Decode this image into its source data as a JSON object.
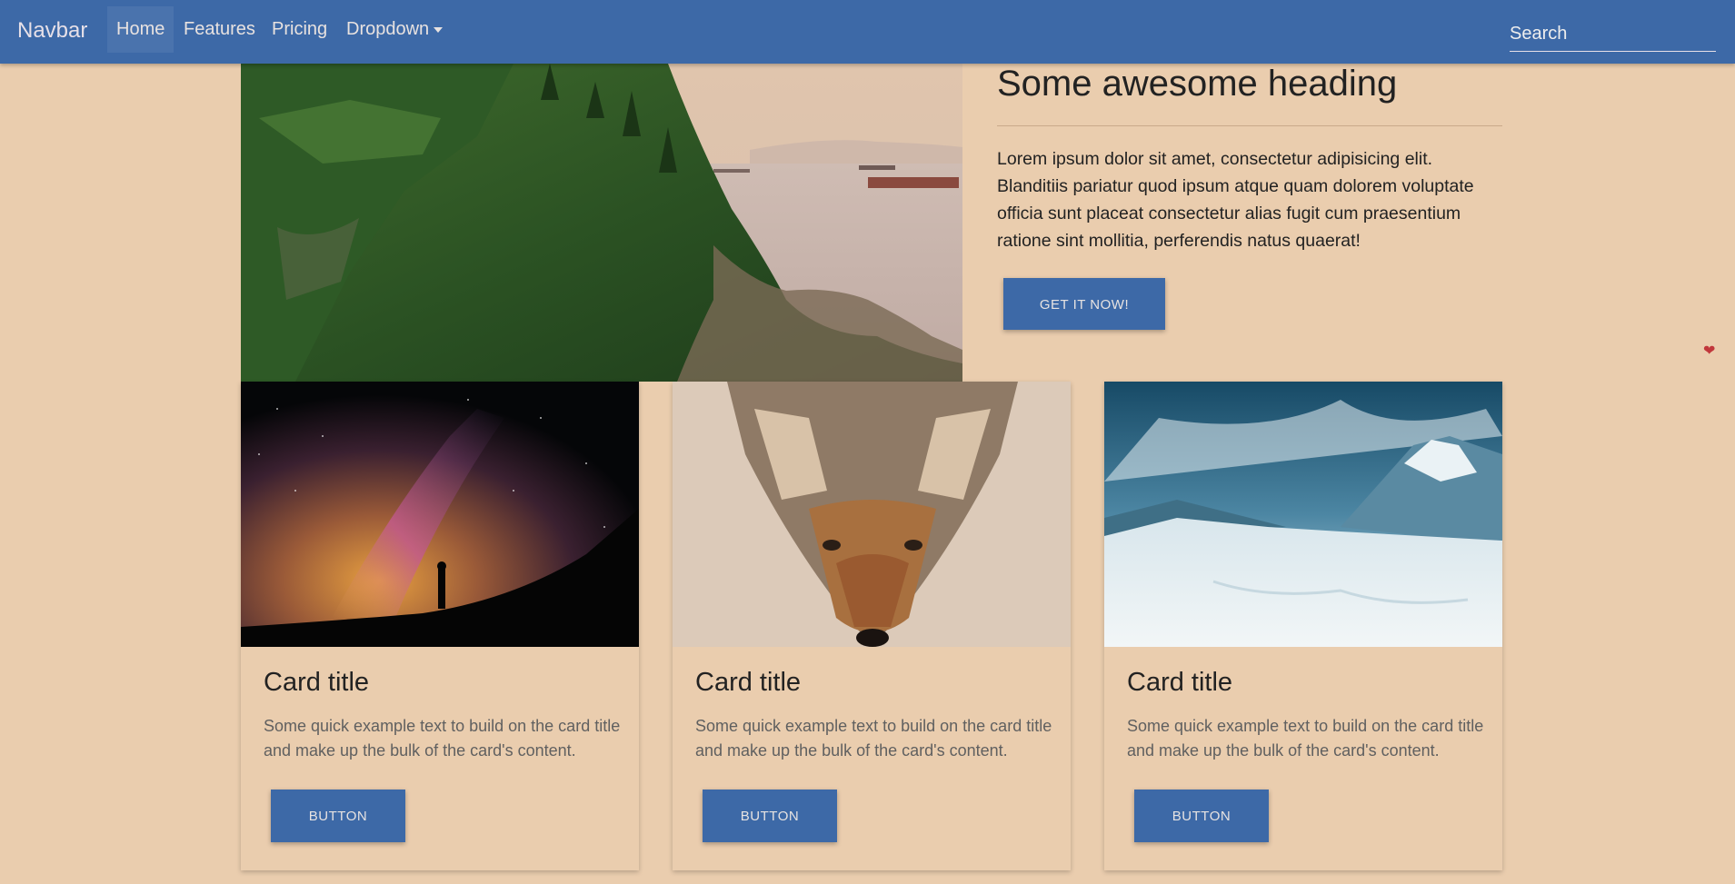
{
  "navbar": {
    "brand": "Navbar",
    "items": [
      {
        "label": "Home"
      },
      {
        "label": "Features"
      },
      {
        "label": "Pricing"
      },
      {
        "label": "Dropdown"
      }
    ],
    "search_placeholder": "Search",
    "color": "#3d69a7"
  },
  "hero": {
    "heading": "Some awesome heading",
    "text": "Lorem ipsum dolor sit amet, consectetur adipisicing elit. Blanditiis pariatur quod ipsum atque quam dolorem voluptate officia sunt placeat consectetur alias fugit cum praesentium ratione sint mollitia, perferendis natus quaerat!",
    "button": "GET IT NOW!"
  },
  "cards": [
    {
      "title": "Card title",
      "text": "Some quick example text to build on the card title and make up the bulk of the card's content.",
      "button": "BUTTON"
    },
    {
      "title": "Card title",
      "text": "Some quick example text to build on the card title and make up the bulk of the card's content.",
      "button": "BUTTON"
    },
    {
      "title": "Card title",
      "text": "Some quick example text to build on the card title and make up the bulk of the card's content.",
      "button": "BUTTON"
    }
  ],
  "icons": {
    "heart": "heart-icon",
    "dropdown_caret": "chevron-down-icon"
  },
  "colors": {
    "background": "#eacdae",
    "accent": "#3d69a7",
    "heart": "#c1373b"
  }
}
